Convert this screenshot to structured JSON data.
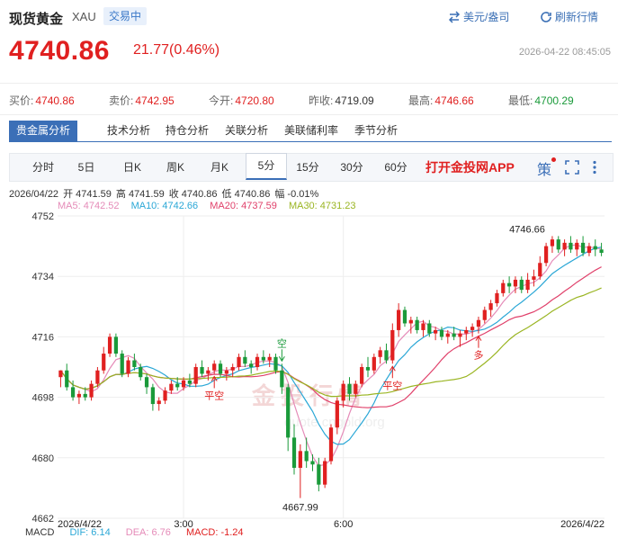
{
  "header": {
    "title": "现货黄金",
    "code": "XAU",
    "status": "交易中",
    "currency_toggle": "美元/盎司",
    "refresh": "刷新行情"
  },
  "price": {
    "last": "4740.86",
    "change": "21.77(0.46%)",
    "timestamp": "2026-04-22 08:45:05"
  },
  "quotes": [
    {
      "label": "买价:",
      "value": "4740.86",
      "tone": "red"
    },
    {
      "label": "卖价:",
      "value": "4742.95",
      "tone": "red"
    },
    {
      "label": "今开:",
      "value": "4720.80",
      "tone": "red"
    },
    {
      "label": "昨收:",
      "value": "4719.09",
      "tone": "blk"
    },
    {
      "label": "最高:",
      "value": "4746.66",
      "tone": "red"
    },
    {
      "label": "最低:",
      "value": "4700.29",
      "tone": "grn"
    }
  ],
  "analysis_tabs": [
    "贵金属分析",
    "技术分析",
    "持仓分析",
    "关联分析",
    "美联储利率",
    "季节分析"
  ],
  "period_tabs": [
    "分时",
    "5日",
    "日K",
    "周K",
    "月K",
    "5分",
    "15分",
    "30分",
    "60分"
  ],
  "active_period": "5分",
  "app_link": "打开金投网APP",
  "ohlc": {
    "date": "2026/04/22",
    "open": "开 4741.59",
    "high": "高 4741.59",
    "close": "收 4740.86",
    "low": "低 4740.86",
    "amp": "幅 -0.01%"
  },
  "ma_legend": [
    {
      "label": "MA5: 4742.52",
      "color": "#e58bb8"
    },
    {
      "label": "MA10: 4742.66",
      "color": "#2aa7d6"
    },
    {
      "label": "MA20: 4737.59",
      "color": "#e0406a"
    },
    {
      "label": "MA30: 4731.23",
      "color": "#9ab522"
    }
  ],
  "macd_legend": [
    {
      "label": "MACD",
      "color": "#333333"
    },
    {
      "label": "DIF: 6.14",
      "color": "#2aa7d6"
    },
    {
      "label": "DEA: 6.76",
      "color": "#e58bb8"
    },
    {
      "label": "MACD: -1.24",
      "color": "#e02020"
    }
  ],
  "watermark": {
    "text": "金投行情",
    "url": "quote.cngold.org"
  },
  "colors": {
    "up": "#e02020",
    "down": "#1a9a3a",
    "accent": "#3b6fb7"
  },
  "chart_data": {
    "type": "candlestick",
    "ylim": [
      4662,
      4752
    ],
    "y_ticks": [
      "4752",
      "4734",
      "4716",
      "4698",
      "4680",
      "4662"
    ],
    "x_ticks": [
      "2026/4/22",
      "3:00",
      "6:00",
      "2026/4/22"
    ],
    "high_label": "4746.66",
    "low_label": "4667.99",
    "markers": [
      {
        "text": "空",
        "index": 36,
        "pos": "above"
      },
      {
        "text": "平空",
        "index": 25,
        "pos": "below"
      },
      {
        "text": "平空",
        "index": 54,
        "pos": "below"
      },
      {
        "text": "多",
        "index": 68,
        "pos": "below"
      }
    ],
    "candles": [
      [
        4704,
        4706,
        4701,
        4706
      ],
      [
        4706,
        4708,
        4700,
        4701
      ],
      [
        4701,
        4703,
        4697,
        4698
      ],
      [
        4698,
        4700,
        4696,
        4699
      ],
      [
        4699,
        4701,
        4697,
        4698
      ],
      [
        4698,
        4703,
        4697,
        4702
      ],
      [
        4702,
        4707,
        4701,
        4706
      ],
      [
        4706,
        4713,
        4705,
        4711
      ],
      [
        4711,
        4717,
        4710,
        4716
      ],
      [
        4716,
        4717,
        4710,
        4711
      ],
      [
        4711,
        4712,
        4704,
        4705
      ],
      [
        4705,
        4710,
        4704,
        4709
      ],
      [
        4709,
        4711,
        4706,
        4707
      ],
      [
        4707,
        4708,
        4703,
        4704
      ],
      [
        4704,
        4705,
        4699,
        4701
      ],
      [
        4701,
        4702,
        4694,
        4696
      ],
      [
        4696,
        4698,
        4694,
        4697
      ],
      [
        4697,
        4701,
        4696,
        4700
      ],
      [
        4700,
        4703,
        4699,
        4702
      ],
      [
        4702,
        4704,
        4700,
        4701
      ],
      [
        4701,
        4704,
        4700,
        4703
      ],
      [
        4703,
        4705,
        4701,
        4702
      ],
      [
        4702,
        4708,
        4701,
        4707
      ],
      [
        4707,
        4709,
        4704,
        4705
      ],
      [
        4705,
        4707,
        4703,
        4706
      ],
      [
        4706,
        4709,
        4705,
        4708
      ],
      [
        4708,
        4709,
        4704,
        4705
      ],
      [
        4705,
        4707,
        4703,
        4706
      ],
      [
        4706,
        4708,
        4704,
        4707
      ],
      [
        4707,
        4711,
        4706,
        4710
      ],
      [
        4710,
        4712,
        4707,
        4708
      ],
      [
        4708,
        4709,
        4705,
        4707
      ],
      [
        4707,
        4711,
        4706,
        4710
      ],
      [
        4710,
        4712,
        4708,
        4709
      ],
      [
        4709,
        4711,
        4707,
        4710
      ],
      [
        4710,
        4711,
        4705,
        4706
      ],
      [
        4706,
        4708,
        4699,
        4701
      ],
      [
        4701,
        4702,
        4682,
        4686
      ],
      [
        4686,
        4690,
        4675,
        4677
      ],
      [
        4677,
        4684,
        4668,
        4682
      ],
      [
        4682,
        4686,
        4677,
        4679
      ],
      [
        4679,
        4681,
        4676,
        4678
      ],
      [
        4678,
        4680,
        4670,
        4672
      ],
      [
        4672,
        4680,
        4671,
        4679
      ],
      [
        4679,
        4690,
        4678,
        4689
      ],
      [
        4689,
        4698,
        4687,
        4697
      ],
      [
        4697,
        4703,
        4695,
        4702
      ],
      [
        4702,
        4704,
        4697,
        4699
      ],
      [
        4699,
        4703,
        4698,
        4702
      ],
      [
        4702,
        4708,
        4701,
        4707
      ],
      [
        4707,
        4710,
        4704,
        4706
      ],
      [
        4706,
        4711,
        4705,
        4710
      ],
      [
        4710,
        4713,
        4708,
        4712
      ],
      [
        4712,
        4714,
        4708,
        4709
      ],
      [
        4709,
        4720,
        4708,
        4718
      ],
      [
        4718,
        4726,
        4716,
        4724
      ],
      [
        4724,
        4725,
        4719,
        4720
      ],
      [
        4720,
        4722,
        4717,
        4721
      ],
      [
        4721,
        4722,
        4717,
        4718
      ],
      [
        4718,
        4721,
        4716,
        4720
      ],
      [
        4720,
        4721,
        4716,
        4717
      ],
      [
        4717,
        4719,
        4715,
        4718
      ],
      [
        4718,
        4719,
        4715,
        4716
      ],
      [
        4716,
        4718,
        4714,
        4717
      ],
      [
        4717,
        4719,
        4715,
        4716
      ],
      [
        4716,
        4718,
        4713,
        4717
      ],
      [
        4717,
        4719,
        4715,
        4718
      ],
      [
        4718,
        4720,
        4716,
        4719
      ],
      [
        4719,
        4722,
        4717,
        4721
      ],
      [
        4721,
        4725,
        4720,
        4724
      ],
      [
        4724,
        4727,
        4722,
        4726
      ],
      [
        4726,
        4730,
        4725,
        4729
      ],
      [
        4729,
        4733,
        4728,
        4732
      ],
      [
        4732,
        4734,
        4729,
        4731
      ],
      [
        4731,
        4734,
        4729,
        4733
      ],
      [
        4733,
        4734,
        4729,
        4730
      ],
      [
        4730,
        4735,
        4729,
        4733
      ],
      [
        4733,
        4736,
        4731,
        4734
      ],
      [
        4734,
        4740,
        4733,
        4738
      ],
      [
        4738,
        4744,
        4737,
        4743
      ],
      [
        4743,
        4746,
        4741,
        4745
      ],
      [
        4745,
        4746,
        4741,
        4742
      ],
      [
        4742,
        4745,
        4740,
        4744
      ],
      [
        4744,
        4746,
        4741,
        4742
      ],
      [
        4742,
        4745,
        4740,
        4744
      ],
      [
        4744,
        4746,
        4740,
        4741
      ],
      [
        4741,
        4744,
        4740,
        4743
      ],
      [
        4743,
        4745,
        4740,
        4742
      ],
      [
        4742,
        4744,
        4740,
        4741
      ]
    ]
  }
}
